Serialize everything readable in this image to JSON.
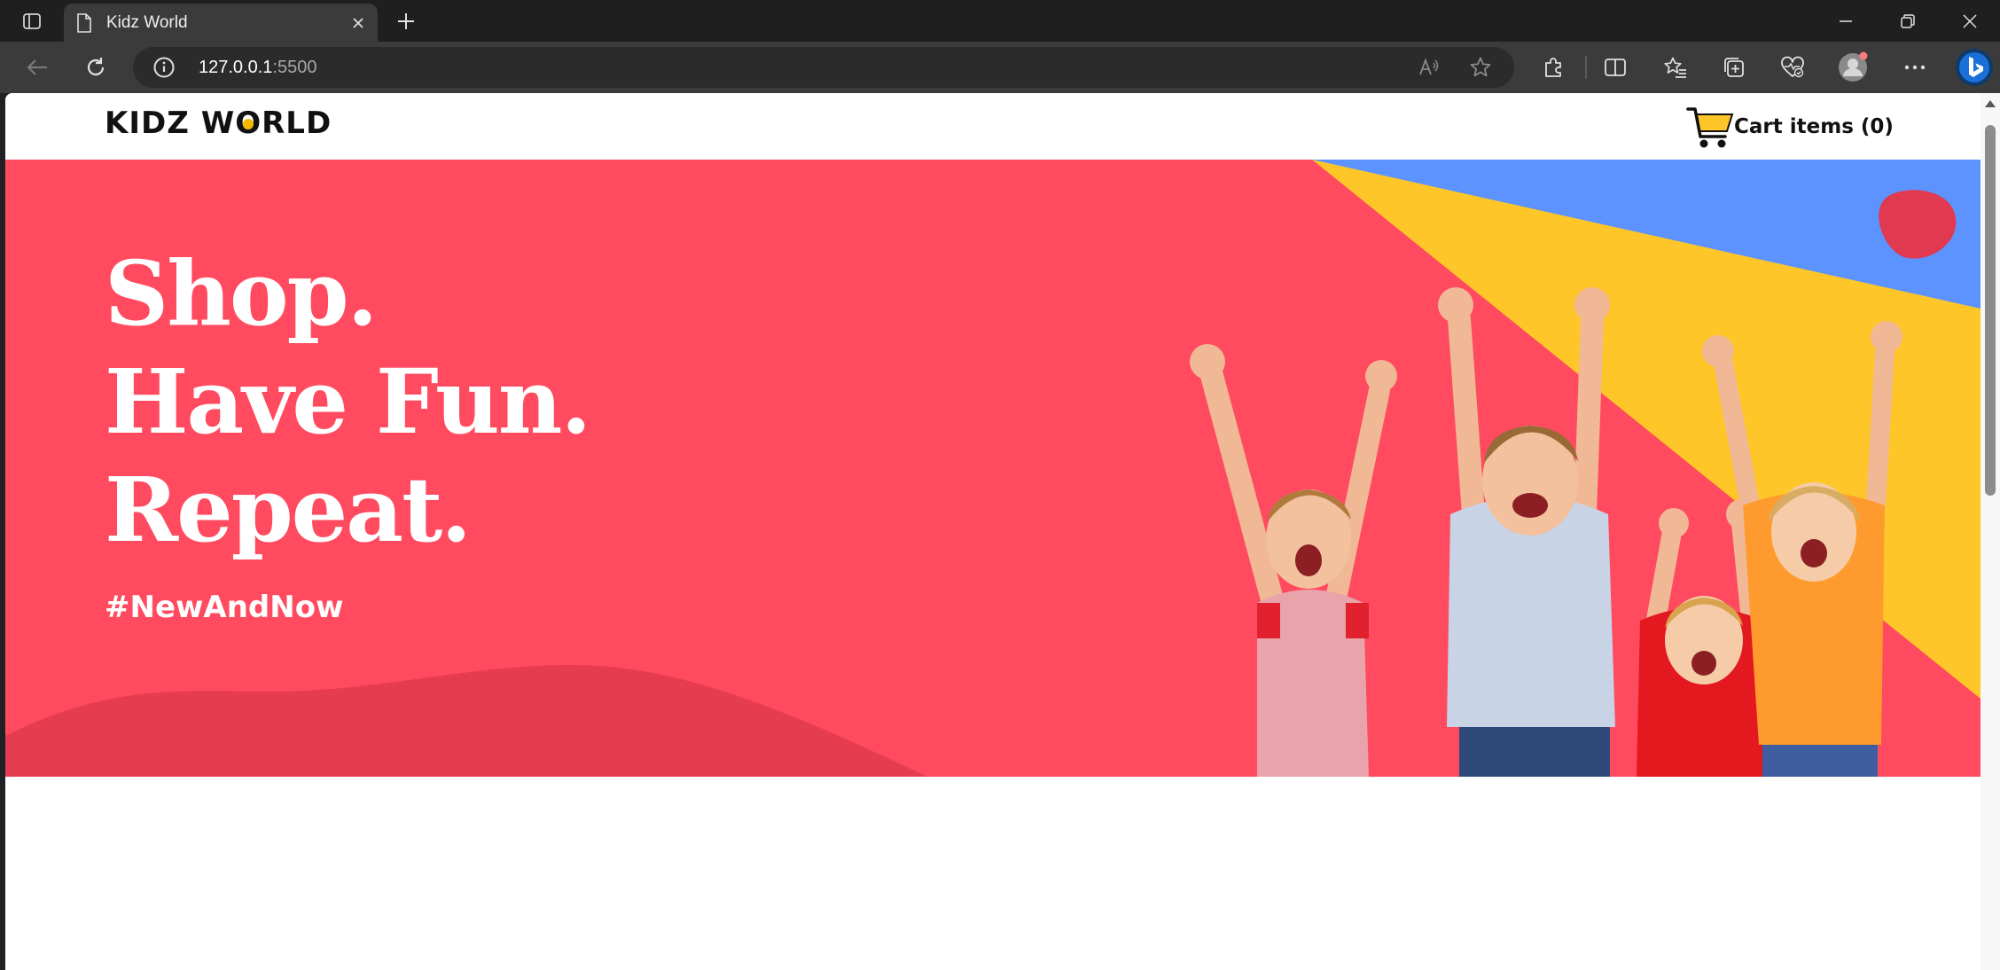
{
  "browser": {
    "tab_title": "Kidz World",
    "url_host": "127.0.0.1",
    "url_port": ":5500"
  },
  "site": {
    "logo": {
      "prefix": "KIDZ W",
      "o": "O",
      "suffix": "RLD"
    },
    "cart_label": "Cart items (0)",
    "hero": {
      "line1": "Shop.",
      "line2": "Have Fun.",
      "line3": "Repeat.",
      "hashtag": "#NewAndNow"
    }
  },
  "colors": {
    "hero_red": "#ff4a5f",
    "yellow": "#ffc629",
    "blue": "#5c93ff",
    "accent_dark_red": "#e1394f"
  }
}
